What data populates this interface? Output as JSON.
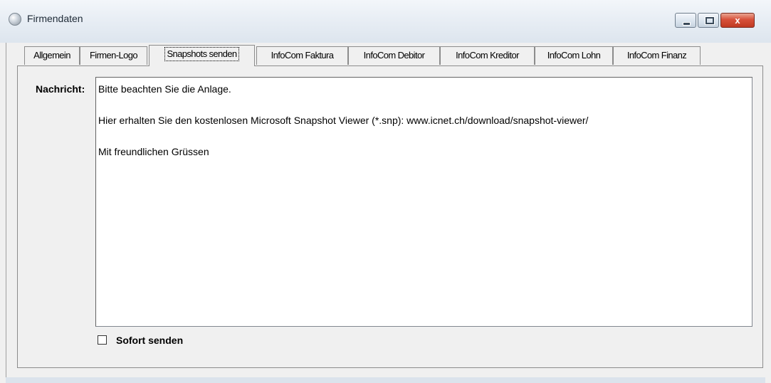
{
  "window": {
    "title": "Firmendaten",
    "icon": "app-orb-icon",
    "minimize_icon": "minimize-icon",
    "maximize_icon": "maximize-icon",
    "close_icon": "close-icon",
    "close_label": "x",
    "accent_close": "#c03a22"
  },
  "tabs": [
    {
      "label": "Allgemein",
      "active": false
    },
    {
      "label": "Firmen-Logo",
      "active": false
    },
    {
      "label": "Snapshots senden",
      "active": true
    },
    {
      "label": "InfoCom Faktura",
      "active": false
    },
    {
      "label": "InfoCom Debitor",
      "active": false
    },
    {
      "label": "InfoCom Kreditor",
      "active": false
    },
    {
      "label": "InfoCom Lohn",
      "active": false
    },
    {
      "label": "InfoCom Finanz",
      "active": false
    }
  ],
  "message": {
    "label": "Nachricht:",
    "lines": [
      "Bitte beachten Sie die Anlage.",
      "Hier erhalten Sie den kostenlosen Microsoft Snapshot Viewer (*.snp): www.icnet.ch/download/snapshot-viewer/",
      "Mit freundlichen Grüssen"
    ]
  },
  "send_now": {
    "label": "Sofort senden",
    "checked": false
  }
}
